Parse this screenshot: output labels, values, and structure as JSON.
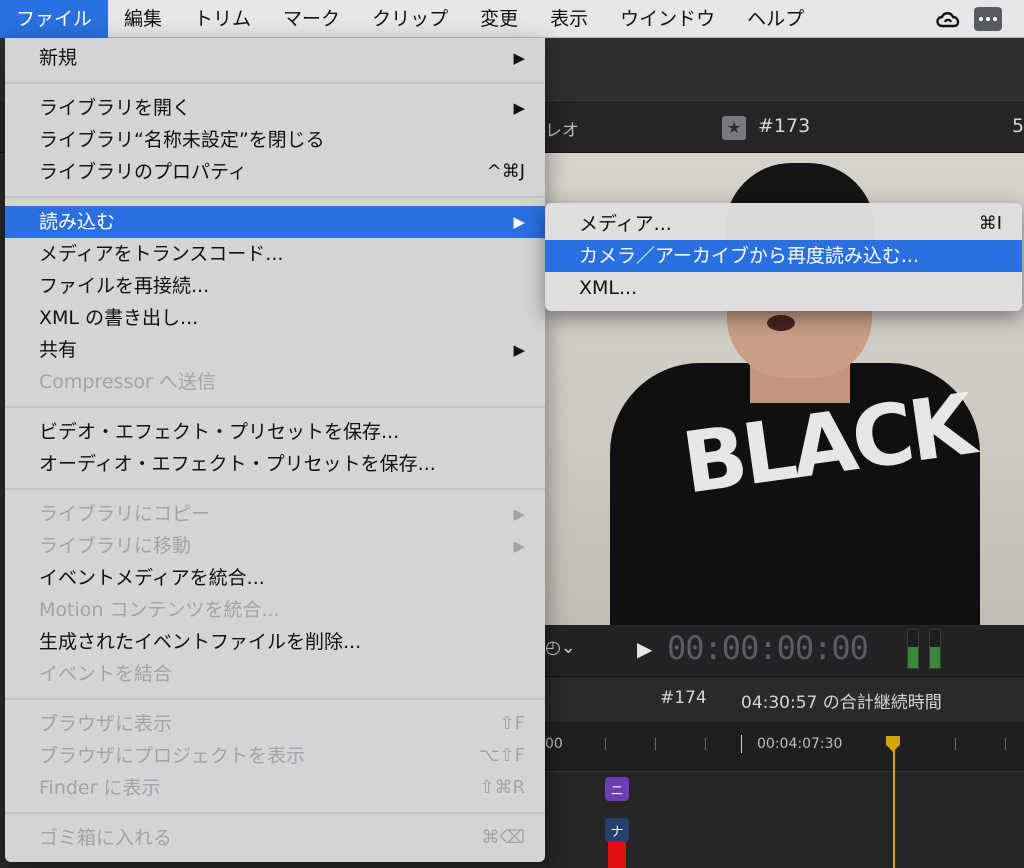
{
  "menubar": {
    "items": [
      "ファイル",
      "編集",
      "トリム",
      "マーク",
      "クリップ",
      "変更",
      "表示",
      "ウインドウ",
      "ヘルプ"
    ],
    "active_index": 0,
    "status_icons": [
      "creative-cloud-icon",
      "more-icon"
    ]
  },
  "file_menu": {
    "groups": [
      {
        "items": [
          {
            "label": "新規",
            "submenu": true
          }
        ]
      },
      {
        "items": [
          {
            "label": "ライブラリを開く",
            "submenu": true
          },
          {
            "label": "ライブラリ“名称未設定”を閉じる"
          },
          {
            "label": "ライブラリのプロパティ",
            "shortcut": "^⌘J"
          }
        ]
      },
      {
        "items": [
          {
            "label": "読み込む",
            "submenu": true,
            "highlighted": true
          },
          {
            "label": "メディアをトランスコード..."
          },
          {
            "label": "ファイルを再接続..."
          },
          {
            "label": "XML の書き出し..."
          },
          {
            "label": "共有",
            "submenu": true
          },
          {
            "label": "Compressor へ送信",
            "disabled": true
          }
        ]
      },
      {
        "items": [
          {
            "label": "ビデオ・エフェクト・プリセットを保存..."
          },
          {
            "label": "オーディオ・エフェクト・プリセットを保存..."
          }
        ]
      },
      {
        "items": [
          {
            "label": "ライブラリにコピー",
            "submenu": true,
            "disabled": true
          },
          {
            "label": "ライブラリに移動",
            "submenu": true,
            "disabled": true
          },
          {
            "label": "イベントメディアを統合..."
          },
          {
            "label": "Motion コンテンツを統合...",
            "disabled": true
          },
          {
            "label": "生成されたイベントファイルを削除..."
          },
          {
            "label": "イベントを結合",
            "disabled": true
          }
        ]
      },
      {
        "items": [
          {
            "label": "ブラウザに表示",
            "shortcut": "⇧F",
            "disabled": true
          },
          {
            "label": "ブラウザにプロジェクトを表示",
            "shortcut": "⌥⇧F",
            "disabled": true
          },
          {
            "label": "Finder に表示",
            "shortcut": "⇧⌘R",
            "disabled": true
          }
        ]
      },
      {
        "items": [
          {
            "label": "ゴミ箱に入れる",
            "shortcut": "⌘⌫",
            "disabled": true
          }
        ]
      }
    ]
  },
  "import_submenu": {
    "items": [
      {
        "label": "メディア...",
        "shortcut": "⌘I"
      },
      {
        "label": "カメラ／アーカイブから再度読み込む...",
        "highlighted": true
      },
      {
        "label": "XML..."
      }
    ]
  },
  "viewer": {
    "header_left": "レオ",
    "clip_name": "#173",
    "header_right": "5",
    "shirt_print": "BLACK",
    "timecode": "00:00:00:00",
    "play_glyph": "▶",
    "speed_glyph": "◴⌄",
    "audio_meter_levels": [
      0.55,
      0.55
    ]
  },
  "timeline": {
    "clip_name": "#174",
    "duration_text": "04:30:57 の合計継続時間",
    "ruler_left": "00",
    "ruler_time": "00:04:07:30",
    "marker_purple_text": "ニ",
    "marker_blue_text": "ナ"
  },
  "colors": {
    "highlight": "#2a70e0",
    "menu_bg": "#dadadc",
    "playhead": "#d4a400",
    "clip_red": "#e01010",
    "marker_purple": "#6b3fb0"
  }
}
